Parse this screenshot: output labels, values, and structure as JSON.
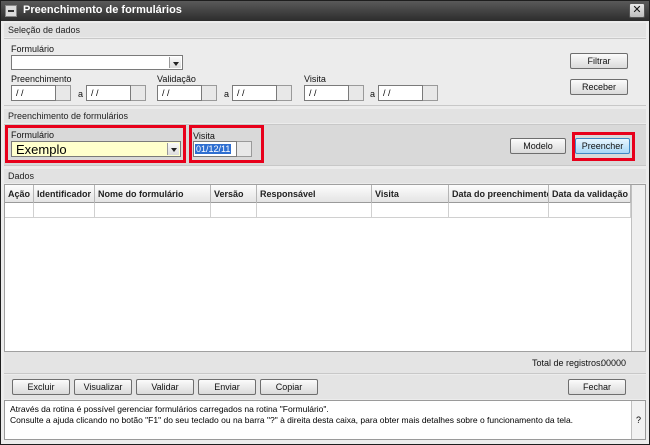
{
  "window": {
    "title": "Preenchimento de formulários",
    "close_glyph": "✕"
  },
  "selecao": {
    "header": "Seleção de dados",
    "formulario_label": "Formulário",
    "formulario_value": "",
    "preenchimento_label": "Preenchimento",
    "validacao_label": "Validação",
    "visita_label": "Visita",
    "range_sep": "a",
    "date_placeholder": "/ /",
    "filtrar_button": "Filtrar",
    "receber_button": "Receber"
  },
  "preenchimento": {
    "header": "Preenchimento de formulários",
    "formulario_label": "Formulário",
    "formulario_value": "Exemplo",
    "visita_label": "Visita",
    "visita_value": "01/12/11",
    "modelo_button": "Modelo",
    "preencher_button": "Preencher"
  },
  "dados": {
    "header": "Dados",
    "columns": [
      "Ação",
      "Identificador",
      "Nome do formulário",
      "Versão",
      "Responsável",
      "Visita",
      "Data do preenchimento",
      "Data da validação"
    ],
    "total_label": "Total de registros:",
    "total_value": "00000"
  },
  "actions": {
    "excluir": "Excluir",
    "visualizar": "Visualizar",
    "validar": "Validar",
    "enviar": "Enviar",
    "copiar": "Copiar",
    "fechar": "Fechar"
  },
  "help": {
    "line1": "Através da rotina é possível gerenciar formulários carregados na rotina \"Formulário\".",
    "line2": "Consulte a ajuda clicando no botão \"F1\" do seu teclado ou na barra \"?\" à direita desta caixa, para obter mais detalhes sobre o funcionamento da tela.",
    "q_glyph": "?"
  },
  "colors": {
    "highlight": "#e8001b",
    "title_bar": "#2c2c2c",
    "field_yellow": "#ffffcc"
  }
}
